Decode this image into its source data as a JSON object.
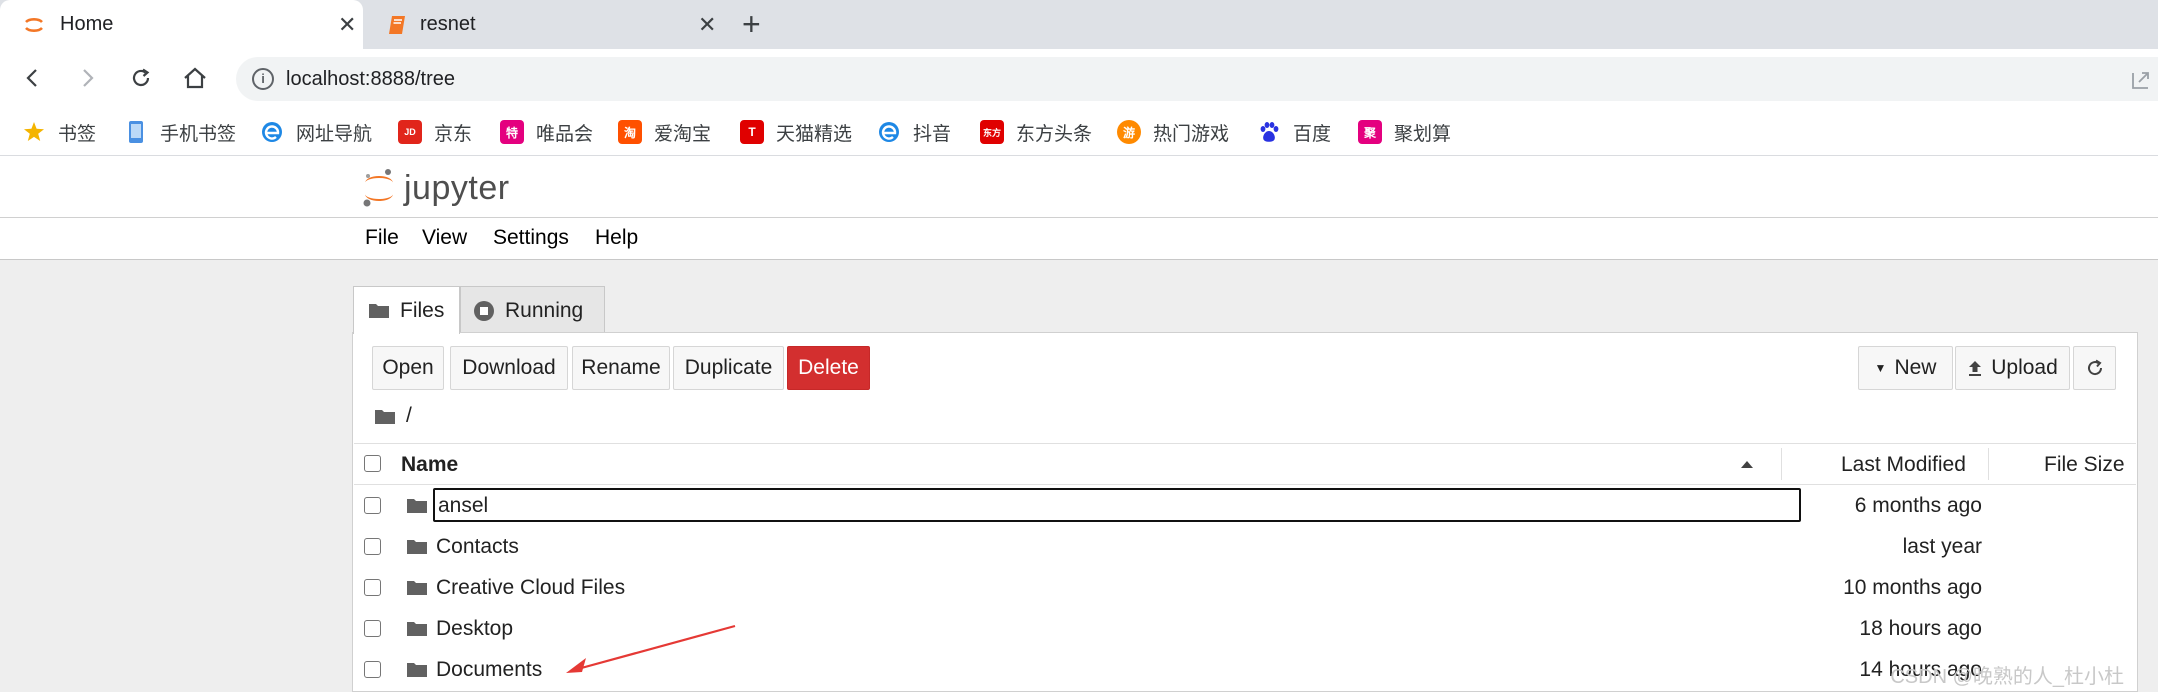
{
  "browser": {
    "tabs": [
      {
        "title": "Home",
        "active": true
      },
      {
        "title": "resnet",
        "active": false
      }
    ],
    "url": "localhost:8888/tree",
    "bookmarks": [
      {
        "label": "书签",
        "icon": "star-icon",
        "color": "#f4b400"
      },
      {
        "label": "手机书签",
        "icon": "phone-icon",
        "color": "#4a90e2"
      },
      {
        "label": "网址导航",
        "icon": "browser-e-icon",
        "color": "#1e88e5"
      },
      {
        "label": "京东",
        "icon": "jd-icon",
        "color": "#e1251b",
        "glyph": "JD"
      },
      {
        "label": "唯品会",
        "icon": "vip-icon",
        "color": "#e4007f",
        "glyph": "特"
      },
      {
        "label": "爱淘宝",
        "icon": "taobao-icon",
        "color": "#ff5000",
        "glyph": "淘"
      },
      {
        "label": "天猫精选",
        "icon": "tmall-icon",
        "color": "#e00000",
        "glyph": "T"
      },
      {
        "label": "抖音",
        "icon": "browser-e-icon",
        "color": "#1e88e5"
      },
      {
        "label": "东方头条",
        "icon": "toutiao-icon",
        "color": "#e00000",
        "glyph": "东方"
      },
      {
        "label": "热门游戏",
        "icon": "game-icon",
        "color": "#ff8a00",
        "glyph": "游"
      },
      {
        "label": "百度",
        "icon": "baidu-paw-icon",
        "color": "#2932e1"
      },
      {
        "label": "聚划算",
        "icon": "juhuasuan-icon",
        "color": "#e4007f",
        "glyph": "聚"
      }
    ]
  },
  "jupyter": {
    "logo_text": "jupyter",
    "menu": [
      "File",
      "View",
      "Settings",
      "Help"
    ],
    "tabs": [
      "Files",
      "Running"
    ],
    "toolbar": {
      "open": "Open",
      "download": "Download",
      "rename": "Rename",
      "duplicate": "Duplicate",
      "delete": "Delete",
      "new": "New",
      "upload": "Upload"
    },
    "breadcrumb": "/",
    "columns": {
      "name": "Name",
      "modified": "Last Modified",
      "size": "File Size"
    },
    "files": [
      {
        "name": "ansel",
        "modified": "6 months ago",
        "renaming": true
      },
      {
        "name": "Contacts",
        "modified": "last year"
      },
      {
        "name": "Creative Cloud Files",
        "modified": "10 months ago"
      },
      {
        "name": "Desktop",
        "modified": "18 hours ago"
      },
      {
        "name": "Documents",
        "modified": "14 hours ago"
      }
    ],
    "accent_color": "#f37726",
    "danger_color": "#d32f2f"
  },
  "annotation": {
    "arrow_color": "#e53935"
  },
  "watermark": "CSDN @晚熟的人_杜小杜"
}
